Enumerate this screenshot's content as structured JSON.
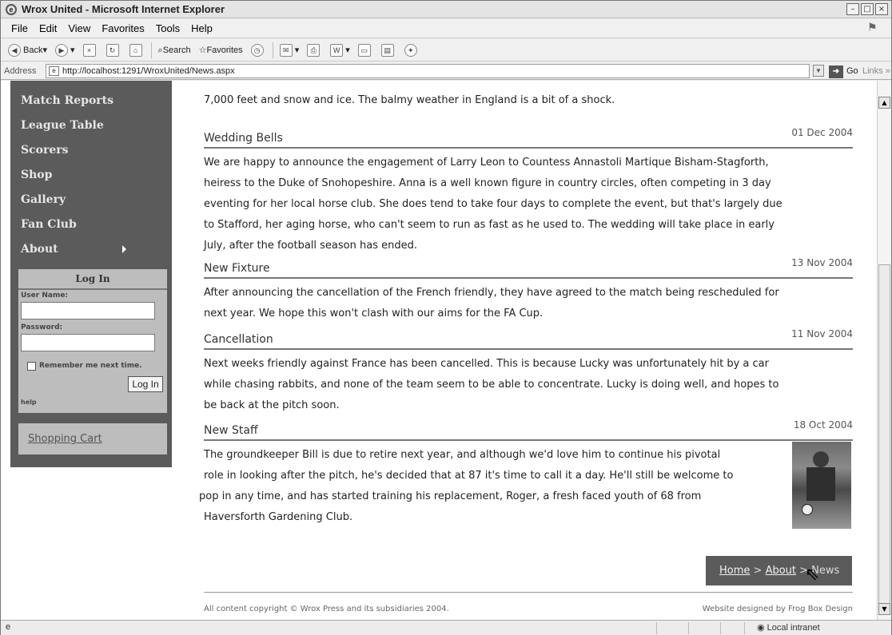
{
  "window": {
    "title": "Wrox United - Microsoft Internet Explorer",
    "controls": [
      "–",
      "□",
      "×"
    ]
  },
  "menu": [
    "File",
    "Edit",
    "View",
    "Favorites",
    "Tools",
    "Help"
  ],
  "toolbar": {
    "back": "Back",
    "search": "Search",
    "favorites": "Favorites"
  },
  "address": {
    "label": "Address",
    "url": "http://localhost:1291/WroxUnited/News.aspx",
    "go": "Go",
    "links": "Links"
  },
  "sidebar": {
    "items": [
      "Match Reports",
      "League Table",
      "Scorers",
      "Shop",
      "Gallery",
      "Fan Club",
      "About"
    ],
    "login": {
      "header": "Log In",
      "username_label": "User Name:",
      "password_label": "Password:",
      "remember_label": "Remember me next time.",
      "button": "Log In",
      "help": "help"
    },
    "cart": "Shopping Cart"
  },
  "content": {
    "lead": "7,000 feet and snow and ice. The balmy weather in England is a bit of a shock.",
    "items": [
      {
        "title": "Wedding Bells",
        "date": "01 Dec 2004",
        "lines": [
          "We are happy to announce the engagement of Larry Leon to Countess Annastoli Martique Bisham-Stagforth,",
          "heiress to the Duke of Snohopeshire. Anna is a well known figure in country circles, often competing in 3 day",
          "eventing for her local horse club. She does tend to take four days to complete the event, but that's largely due",
          "to Stafford, her aging horse, who can't seem to run as fast as he used to. The wedding will take place in early",
          "July, after the football season has ended."
        ]
      },
      {
        "title": "New Fixture",
        "date": "13 Nov 2004",
        "lines": [
          "After announcing the cancellation of the French friendly, they have agreed to the match being rescheduled for",
          "next year. We hope this won't clash with our aims for the FA Cup."
        ]
      },
      {
        "title": "Cancellation",
        "date": "11 Nov 2004",
        "lines": [
          "Next weeks friendly against France has been cancelled. This is because Lucky was unfortunately hit by a car",
          "while chasing rabbits, and none of the team seem to be able to concentrate. Lucky is doing well, and hopes to",
          "be back at the pitch soon."
        ]
      },
      {
        "title": "New Staff",
        "date": "18 Oct 2004",
        "lines": [
          "The groundkeeper Bill is due to retire next year, and although we'd love him to continue his pivotal",
          "role in looking after the pitch, he's decided that at 87 it's time to call it a day. He'll still be welcome to",
          "pop in any time, and has started training his replacement, Roger, a fresh faced youth of 68 from",
          "Haversforth Gardening Club."
        ]
      }
    ]
  },
  "breadcrumb": {
    "home": "Home",
    "sep1": " > ",
    "about": "About",
    "sep2": " > ",
    "current": "News"
  },
  "footer": {
    "left": "All content copyright © Wrox Press and its subsidiaries 2004.",
    "right": "Website designed by Frog Box Design"
  },
  "status": {
    "zone": "Local intranet"
  }
}
